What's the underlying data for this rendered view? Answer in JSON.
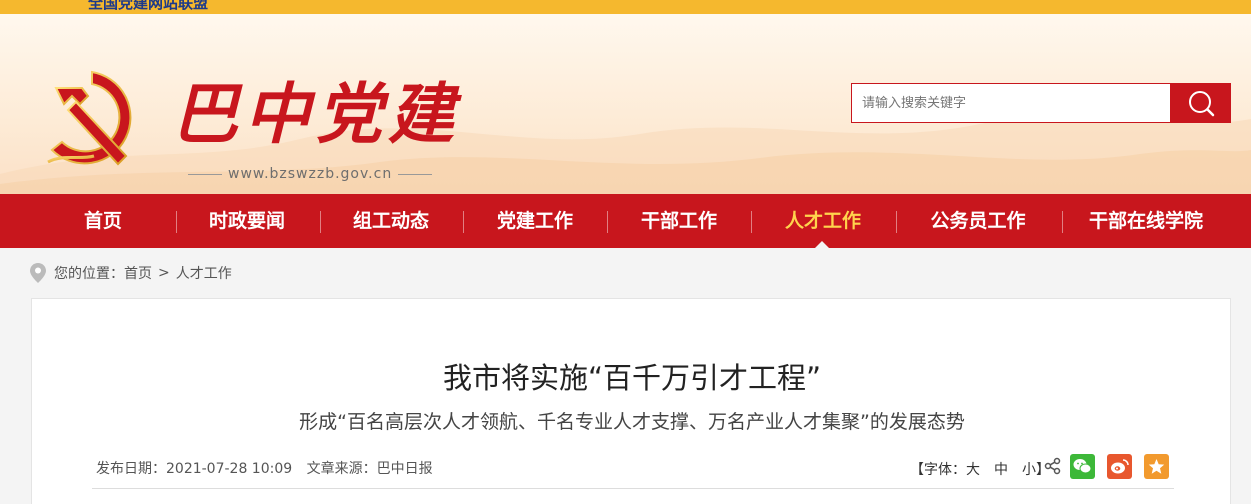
{
  "topbar": {
    "text": "全国党建网站联盟"
  },
  "header": {
    "site_title": "巴中党建",
    "site_url": "www.bzswzzb.gov.cn",
    "emblem_icon": "party-emblem-icon",
    "brand_color": "#c8161d"
  },
  "search": {
    "placeholder": "请输入搜索关键字",
    "icon": "search-icon"
  },
  "nav": {
    "items": [
      {
        "label": "首页"
      },
      {
        "label": "时政要闻"
      },
      {
        "label": "组工动态"
      },
      {
        "label": "党建工作"
      },
      {
        "label": "干部工作"
      },
      {
        "label": "人才工作",
        "active": true
      },
      {
        "label": "公务员工作"
      },
      {
        "label": "干部在线学院"
      }
    ],
    "active_color": "#ffd34d"
  },
  "breadcrumb": {
    "prefix": "您的位置：",
    "home": "首页",
    "separator": ">",
    "current": "人才工作",
    "icon": "location-pin-icon"
  },
  "article": {
    "title": "我市将实施“百千万引才工程”",
    "subtitle": "形成“百名高层次人才领航、千名专业人才支撑、万名产业人才集聚”的发展态势",
    "publish_date": "发布日期：2021-07-28 10:09",
    "source": "文章来源：巴中日报",
    "font_label": "【字体：",
    "font_large": "大",
    "font_medium": "中",
    "font_small": "小",
    "font_close": "】",
    "share_icons": [
      "share-icon",
      "wechat-icon",
      "weibo-icon",
      "favorite-icon"
    ]
  }
}
